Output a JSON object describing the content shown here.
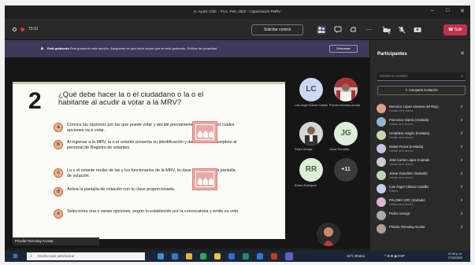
{
  "window": {
    "title": "H. Ayunt. Chih. - Proc. Part. 2022 - Capacitación FMRV",
    "controls": [
      "–",
      "□",
      "✕"
    ]
  },
  "toolbar": {
    "timer": "73:31",
    "request_control": "Solicitar control",
    "leave": "Salir"
  },
  "banner": {
    "title": "Está grabando",
    "text": "Está grabando esta reunión. Asegúrese de que todos sepan que se está grabando.",
    "link": "Política de privacidad",
    "dismiss": "Descartar"
  },
  "slide": {
    "number": "2",
    "question": "¿Qué debe hacer la o el ciudadano o la o el habitante al acudir a votar a la MRV?",
    "options": [
      {
        "letter": "a",
        "text": "Conoce las opciones por las que puede votar y decide previamente por cuál o por cuales opciones va a votar."
      },
      {
        "letter": "b",
        "text": "Al ingresar a la MRV, la o el votante presenta su identificación y da su nombre completo al personal de Registro de votantes."
      },
      {
        "letter": "c",
        "text": "La o el votante recibe de las y los funcionarios de la MRV, la clave para activar la pantalla de votación."
      },
      {
        "letter": "d",
        "text": "Activa la pantalla de votación con la clave proporcionada."
      },
      {
        "letter": "e",
        "text": "Selecciona una o varias opciones, según lo establecido por la convocatoria y emite su voto."
      }
    ]
  },
  "presenter_label": "Priscila Tormolay Acosta",
  "tiles": [
    {
      "initials": "LC",
      "name": "Luis Ángel Chávez Castillo",
      "color": "#cfd8f2",
      "text_color": "#3a4a86"
    },
    {
      "initials": "",
      "name": "Priscila Tormolay Acosta",
      "color": "#b9b9b9",
      "text_color": "#333"
    },
    {
      "initials": "",
      "name": "Pedro Urenga",
      "color": "#9a9a9a",
      "text_color": "#333"
    },
    {
      "initials": "JG",
      "name": "Josue González",
      "color": "#dfeeda",
      "text_color": "#3f6b3a"
    },
    {
      "initials": "RR",
      "name": "Ruben Rodríguez",
      "color": "#dfeeda",
      "text_color": "#3f6b3a"
    },
    {
      "initials": "+11",
      "name": "",
      "color": "#3a3a3a",
      "text_color": "#eee"
    },
    {
      "initials": "",
      "name": "",
      "color": "#2a2a2a",
      "text_color": "#eee"
    }
  ],
  "panel": {
    "title": "Participantes",
    "search_placeholder": "Escribe un nombre",
    "share_button": "Compartir invitación",
    "participants": [
      {
        "name": "Berenice López asesora del Regi...",
        "sub": "Invitado de la reunión",
        "color": "#d9a08a"
      },
      {
        "name": "Francisco García (Invitado)",
        "sub": "Invitado de la reunión",
        "color": "#8fb6d6"
      },
      {
        "name": "Geraldine Aragón (Invitado)",
        "sub": "Invitado de la reunión",
        "color": "#c7d9a8"
      },
      {
        "name": "Isabel Porras (Invitado)",
        "sub": "Invitado de la reunión",
        "color": "#c9c2e6"
      },
      {
        "name": "José Carlos López Andrade",
        "sub": "Invitado de la reunión",
        "color": "#cccccc"
      },
      {
        "name": "Josue González (Invitado)",
        "sub": "Invitado de la reunión",
        "color": "#b7d9b3"
      },
      {
        "name": "Luis Ángel Chávez Castillo",
        "sub": "Externo",
        "color": "#c3cff0"
      },
      {
        "name": "PALOMA CRC (Invitado)",
        "sub": "Invitado de la reunión",
        "color": "#e0b3c8"
      },
      {
        "name": "Pedro Urenga",
        "sub": "",
        "color": "#aaaaaa"
      },
      {
        "name": "Priscila Tormolay Acosta",
        "sub": "",
        "color": "#b59c8a"
      }
    ]
  },
  "taskbar": {
    "search_placeholder": "Escribe aquí para buscar",
    "weather": "15°C Bruma",
    "tray": "^ ⊕ ⊞ ◉ ESP",
    "time": "07:09 p. m.",
    "date": "27/02/2022"
  }
}
